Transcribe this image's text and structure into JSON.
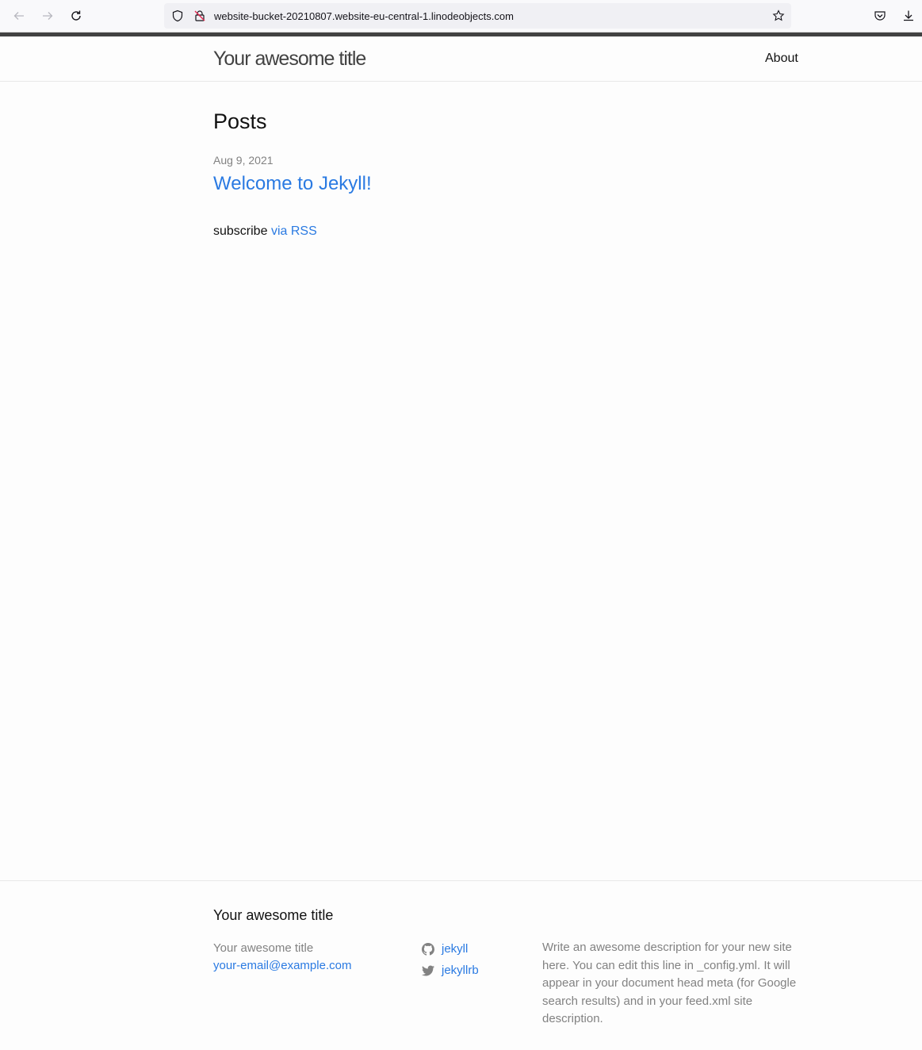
{
  "browser": {
    "url": "website-bucket-20210807.website-eu-central-1.linodeobjects.com",
    "icons": {
      "back": "arrow-left-icon",
      "forward": "arrow-right-icon",
      "reload": "reload-icon",
      "tracking": "shield-icon",
      "insecure": "lock-crossed-icon",
      "bookmark": "star-icon",
      "pocket": "pocket-icon",
      "downloads": "download-icon"
    }
  },
  "header": {
    "site_title": "Your awesome title",
    "nav": [
      {
        "label": "About"
      }
    ]
  },
  "main": {
    "heading": "Posts",
    "posts": [
      {
        "date": "Aug 9, 2021",
        "title": "Welcome to Jekyll!"
      }
    ],
    "rss": {
      "prefix": "subscribe",
      "link": "via RSS"
    }
  },
  "footer": {
    "heading": "Your awesome title",
    "name": "Your awesome title",
    "email": "your-email@example.com",
    "social": [
      {
        "icon": "github-icon",
        "label": "jekyll"
      },
      {
        "icon": "twitter-icon",
        "label": "jekyllrb"
      }
    ],
    "description": "Write an awesome description for your new site here. You can edit this line in _config.yml. It will appear in your document head meta (for Google search results) and in your feed.xml site description."
  },
  "colors": {
    "link": "#2a7ae2",
    "muted": "#828282",
    "text": "#111111",
    "accent_bar": "#424242"
  }
}
